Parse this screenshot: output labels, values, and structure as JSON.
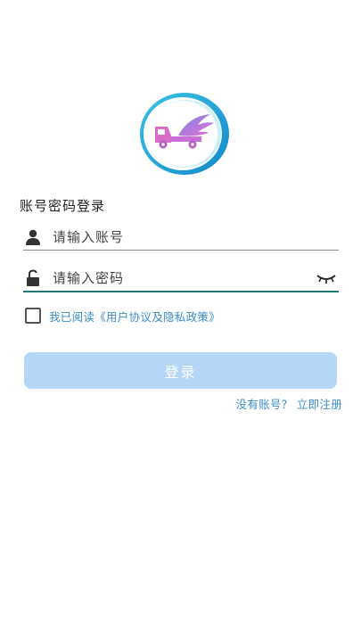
{
  "login": {
    "section_title": "账号密码登录",
    "account_placeholder": "请输入账号",
    "account_value": "",
    "password_placeholder": "请输入密码",
    "password_value": "",
    "agreement_text": "我已阅读《用户协议及隐私政策》",
    "agreement_checked": false,
    "login_button_label": "登录",
    "register_link": "没有账号？ 立即注册"
  },
  "icons": {
    "logo": "truck-wing-logo",
    "account": "user-icon",
    "password": "lock-icon",
    "visibility": "eye-closed-icon"
  },
  "colors": {
    "accent_link": "#3b8dc6",
    "button_disabled": "#b5d6f7",
    "password_underline": "#1f7a72",
    "logo_ring": "#1aa0d8",
    "logo_inner": "#d86fd0"
  }
}
